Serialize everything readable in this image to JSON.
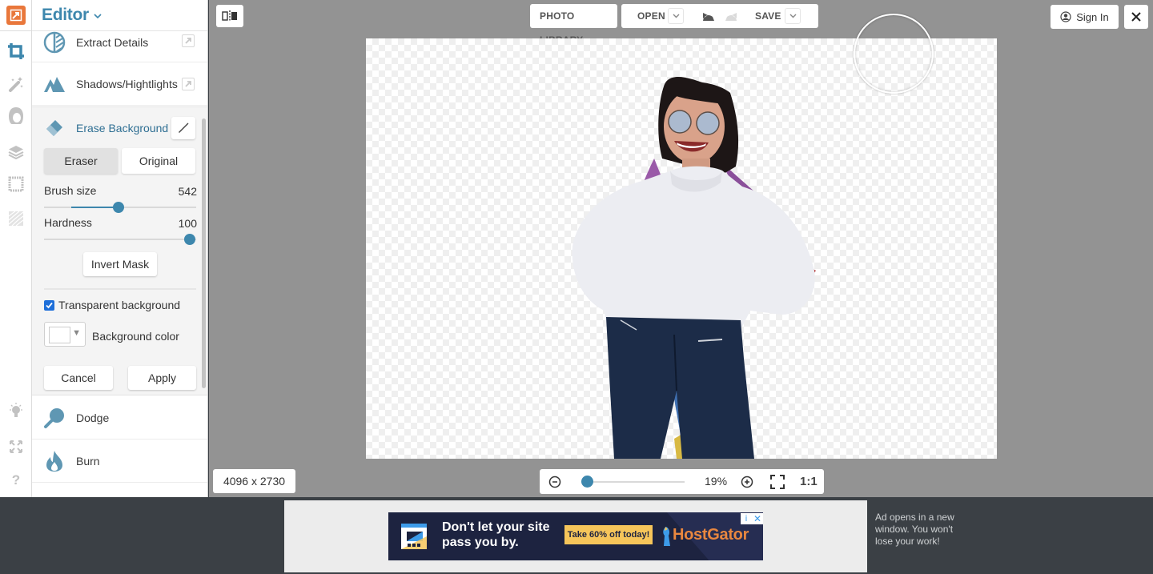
{
  "app": {
    "title": "Editor",
    "brand_color": "#e9773b",
    "accent_color": "#3d87ad"
  },
  "rail": {
    "items": [
      {
        "icon": "crop-icon",
        "active": true
      },
      {
        "icon": "magic-wand-icon",
        "active": false
      },
      {
        "icon": "portrait-icon",
        "active": false
      },
      {
        "icon": "layers-icon",
        "active": false
      },
      {
        "icon": "frame-icon",
        "active": false
      },
      {
        "icon": "texture-icon",
        "active": false
      }
    ],
    "bottom_items": [
      {
        "icon": "lightbulb-icon"
      },
      {
        "icon": "fullscreen-icon"
      },
      {
        "icon": "help-icon",
        "glyph": "?"
      }
    ]
  },
  "panel": {
    "tools_above": [
      {
        "label": "Extract Details",
        "icon": "extract-details-icon"
      },
      {
        "label": "Shadows/Hightlights",
        "icon": "mountain-icon"
      }
    ],
    "erase_background": {
      "title": "Erase Background",
      "modes": [
        "Eraser",
        "Original"
      ],
      "active_mode": "Eraser",
      "brush_size": {
        "label": "Brush size",
        "value": "542",
        "fraction": 0.49
      },
      "hardness": {
        "label": "Hardness",
        "value": "100",
        "fraction": 1.0
      },
      "invert_mask": "Invert Mask",
      "transparent_background": {
        "label": "Transparent background",
        "checked": true
      },
      "background_color": {
        "label": "Background color",
        "value": "#ffffff"
      },
      "cancel": "Cancel",
      "apply": "Apply"
    },
    "tools_below": [
      {
        "label": "Dodge",
        "icon": "dodge-icon"
      },
      {
        "label": "Burn",
        "icon": "burn-icon"
      }
    ]
  },
  "toolbar": {
    "photo_library": "PHOTO LIBRARY",
    "open": "OPEN",
    "save": "SAVE",
    "sign_in": "Sign In"
  },
  "canvas": {
    "dimensions": "4096 x 2730"
  },
  "zoom": {
    "percent": "19%",
    "fraction": 0.0,
    "one_to_one": "1:1"
  },
  "ad": {
    "headline": "Don't let your site pass you by.",
    "cta": "Take 60% off today!",
    "brand": "HostGator",
    "info_glyph": "i",
    "close_glyph": "✕",
    "note": "Ad opens in a new window. You won't lose your work!"
  }
}
